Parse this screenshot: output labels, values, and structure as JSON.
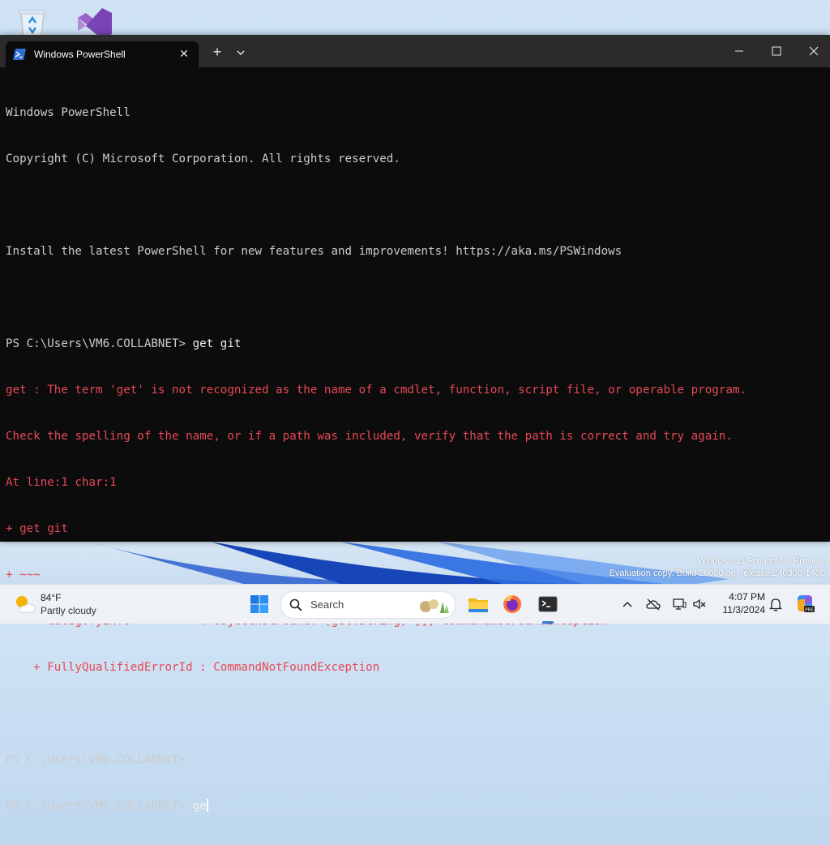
{
  "window": {
    "tab_title": "Windows PowerShell",
    "tab_close": "✕",
    "new_tab": "+",
    "minimize": "minimize",
    "maximize": "maximize",
    "close": "close"
  },
  "console": {
    "lines": [
      {
        "text": "Windows PowerShell",
        "style": "normal"
      },
      {
        "text": "Copyright (C) Microsoft Corporation. All rights reserved.",
        "style": "normal"
      },
      {
        "text": "",
        "style": "normal"
      },
      {
        "text": "Install the latest PowerShell for new features and improvements! https://aka.ms/PSWindows",
        "style": "normal"
      },
      {
        "text": "",
        "style": "normal"
      },
      {
        "prompt": "PS C:\\Users\\VM6.COLLABNET> ",
        "command": "get git",
        "style": "prompt"
      },
      {
        "text": "get : The term 'get' is not recognized as the name of a cmdlet, function, script file, or operable program.",
        "style": "error"
      },
      {
        "text": "Check the spelling of the name, or if a path was included, verify that the path is correct and try again.",
        "style": "error"
      },
      {
        "text": "At line:1 char:1",
        "style": "error"
      },
      {
        "text": "+ get git",
        "style": "error"
      },
      {
        "text": "+ ~~~",
        "style": "error"
      },
      {
        "text": "    + CategoryInfo          : ObjectNotFound: (get:String) [], CommandNotFoundException",
        "style": "error"
      },
      {
        "text": "    + FullyQualifiedErrorId : CommandNotFoundException",
        "style": "error"
      },
      {
        "text": "",
        "style": "normal"
      },
      {
        "prompt": "PS C:\\Users\\VM6.COLLABNET>",
        "command": "",
        "style": "prompt"
      },
      {
        "prompt": "PS C:\\Users\\VM6.COLLABNET> ",
        "command": "ge",
        "style": "prompt-active"
      }
    ]
  },
  "watermark": {
    "line1": "Windows 11 Pro Insider Preview",
    "line2": "Evaluation copy. Build 26080.ge_release.240308-1400"
  },
  "taskbar": {
    "weather_temp": "84°F",
    "weather_condition": "Partly cloudy",
    "search_label": "Search",
    "time": "4:07 PM",
    "date": "11/3/2024"
  },
  "colors": {
    "console_bg": "#0c0c0c",
    "console_text": "#cccccc",
    "error_text": "#e74856",
    "titlebar": "#2b2b2b"
  }
}
